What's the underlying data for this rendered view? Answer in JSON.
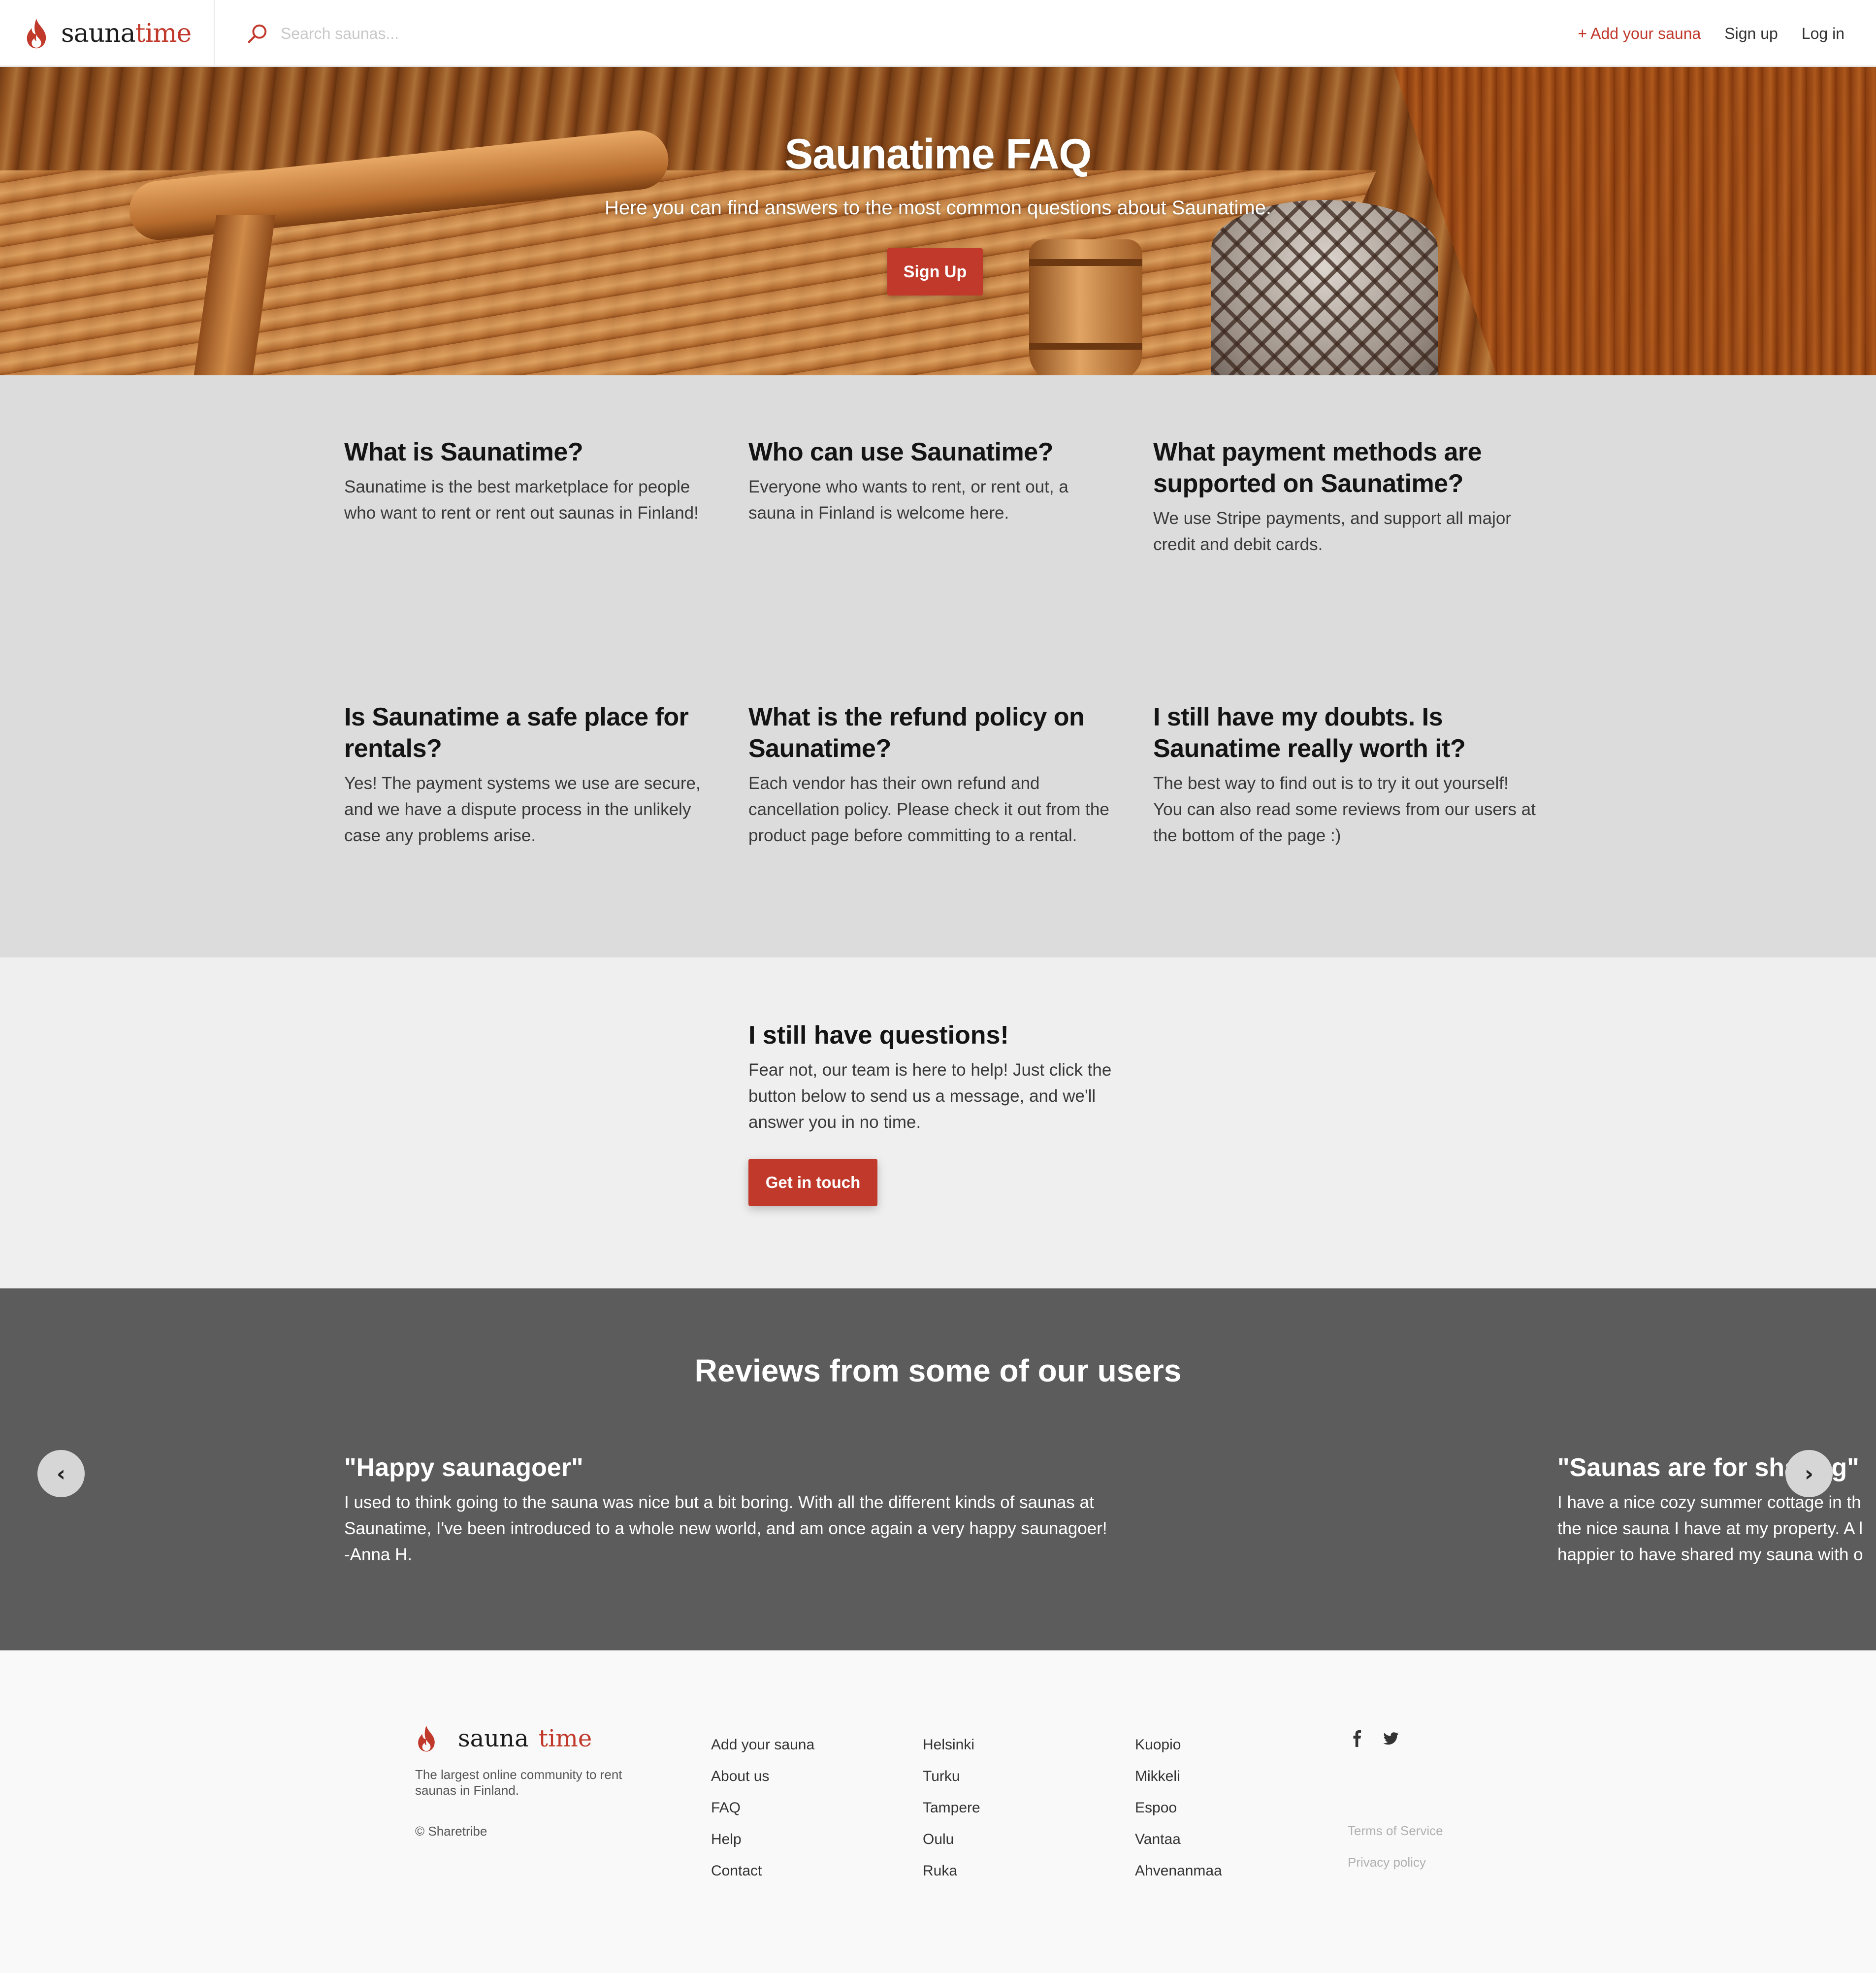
{
  "header": {
    "brand_prefix": "sauna",
    "brand_accent": "time",
    "search_placeholder": "Search saunas...",
    "nav": {
      "add_sauna": "+ Add your sauna",
      "sign_up": "Sign up",
      "log_in": "Log in"
    }
  },
  "hero": {
    "title": "Saunatime FAQ",
    "subtitle": "Here you can find answers to the most common questions about Saunatime.",
    "cta": "Sign Up"
  },
  "faq": [
    {
      "question": "What is Saunatime?",
      "answer": "Saunatime is the best marketplace for people who want to rent or rent out saunas in Finland!"
    },
    {
      "question": "Who can use Saunatime?",
      "answer": "Everyone who wants to rent, or rent out, a sauna in Finland is welcome here."
    },
    {
      "question": "What payment methods are supported on Saunatime?",
      "answer": "We use Stripe payments, and support all major credit and debit cards."
    },
    {
      "question": "Is Saunatime a safe place for rentals?",
      "answer": "Yes! The payment systems we use are secure, and we have a dispute process in the unlikely case any problems arise."
    },
    {
      "question": "What is the refund policy on Saunatime?",
      "answer": "Each vendor has their own refund and cancellation policy. Please check it out from the product page before committing to a rental."
    },
    {
      "question": "I still have my doubts. Is Saunatime really worth it?",
      "answer": "The best way to find out is to try it out yourself! You can also read some reviews from our users at the bottom of the page :)"
    }
  ],
  "questions": {
    "title": "I still have questions!",
    "text": "Fear not, our team is here to help! Just click the button below to send us a message, and we'll answer you in no time.",
    "button": "Get in touch"
  },
  "reviews": {
    "title": "Reviews from some of our users",
    "prev_label": "‹",
    "next_label": "›",
    "items": [
      {
        "title": "\"Happy saunagoer\"",
        "lines": [
          "I used to think going to the sauna was nice but a bit boring. With all the different kinds of saunas at",
          "Saunatime, I've been introduced to a whole new world, and am once again a very happy saunagoer!",
          "-Anna H."
        ]
      },
      {
        "title": "\"Saunas are for sharing\"",
        "lines": [
          "I have a nice cozy summer cottage in th",
          "the nice sauna I have at my property. A l",
          "happier to have shared my sauna with o"
        ]
      }
    ]
  },
  "footer": {
    "brand_prefix": "sauna",
    "brand_accent": "time",
    "tagline": "The largest online community to rent saunas in Finland.",
    "copyright": "© Sharetribe",
    "col1": [
      "Add your sauna",
      "About us",
      "FAQ",
      "Help",
      "Contact"
    ],
    "col2": [
      "Helsinki",
      "Turku",
      "Tampere",
      "Oulu",
      "Ruka"
    ],
    "col3": [
      "Kuopio",
      "Mikkeli",
      "Espoo",
      "Vantaa",
      "Ahvenanmaa"
    ],
    "social": [
      "facebook-icon",
      "twitter-icon"
    ],
    "legal": [
      "Terms of Service",
      "Privacy policy"
    ]
  },
  "colors": {
    "brand_red": "#c0392b",
    "faq_bg": "#dcdcdc",
    "questions_bg": "#efefef",
    "reviews_bg": "#5c5c5c",
    "footer_bg": "#f9f9f9"
  }
}
